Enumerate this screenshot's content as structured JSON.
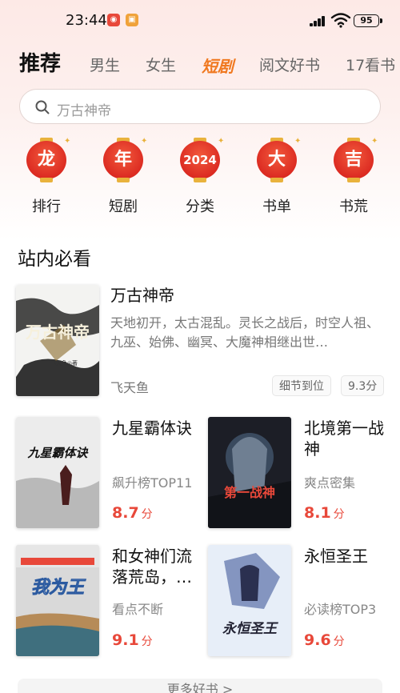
{
  "status_bar": {
    "time": "23:44",
    "battery": "95"
  },
  "tabs": {
    "recommend": "推荐",
    "male": "男生",
    "female": "女生",
    "drama": "短剧",
    "reading": "阅文好书",
    "seventeen": "17看书"
  },
  "search": {
    "placeholder": "万古神帝"
  },
  "categories": [
    {
      "lantern": "龙",
      "label": "排行"
    },
    {
      "lantern": "年",
      "label": "短剧"
    },
    {
      "lantern": "2024",
      "label": "分类"
    },
    {
      "lantern": "大",
      "label": "书单"
    },
    {
      "lantern": "吉",
      "label": "书荒"
    }
  ],
  "section": {
    "title": "站内必看"
  },
  "featured": {
    "title": "万古神帝",
    "description": "天地初开，太古混乱。灵长之战后，时空人祖、九巫、始佛、幽冥、大魔神相继出世…",
    "author": "飞天鱼",
    "tag": "细节到位",
    "score": "9.3分",
    "cover_text": "万古神帝",
    "cover_author": "飞天鱼◎著"
  },
  "books": [
    {
      "title": "九星霸体诀",
      "subtitle": "飙升榜TOP11",
      "score": "8.7",
      "unit": "分",
      "cover_text": "九星霸体诀"
    },
    {
      "title": "北境第一战神",
      "subtitle": "爽点密集",
      "score": "8.1",
      "unit": "分",
      "cover_text": "第一战神"
    },
    {
      "title": "和女神们流落荒岛，…",
      "subtitle": "看点不断",
      "score": "9.1",
      "unit": "分",
      "cover_text": "我为王"
    },
    {
      "title": "永恒圣王",
      "subtitle": "必读榜TOP3",
      "score": "9.6",
      "unit": "分",
      "cover_text": "永恒圣王"
    }
  ],
  "more": {
    "label": "更多好书 >"
  },
  "colors": {
    "accent": "#e8483a",
    "drama_tab": "#f0781f",
    "lantern": "#dc2b22"
  }
}
